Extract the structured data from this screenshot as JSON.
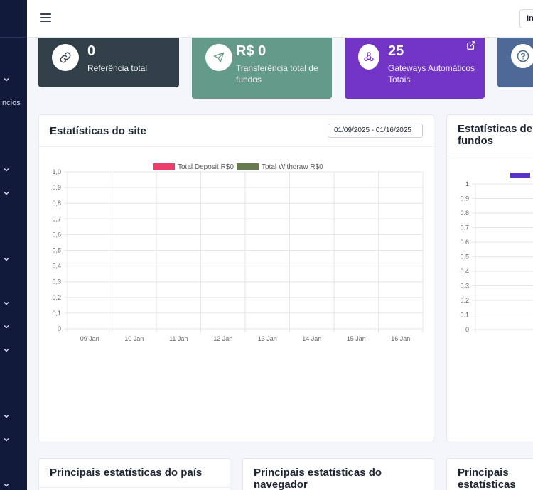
{
  "sidebar": {
    "fragment_label": "ıncios"
  },
  "topbar": {
    "right_button_label": "In"
  },
  "stats": [
    {
      "value": "0",
      "label": "Referência total",
      "color": "#313f48",
      "icon": "link-icon"
    },
    {
      "value": "R$ 0",
      "label": "Transferência total de fundos",
      "color": "#649a89",
      "icon": "send-icon"
    },
    {
      "value": "25",
      "label": "Gateways Automáticos Totais",
      "color": "#7134c4",
      "icon": "webhook-icon"
    },
    {
      "value": "",
      "label": "",
      "color": "#4c6a95",
      "icon": "help-icon"
    }
  ],
  "site_stats": {
    "title": "Estatísticas do site",
    "date_range": "01/09/2025 - 01/16/2025",
    "chart_data": {
      "type": "bar",
      "categories": [
        "09 Jan",
        "10 Jan",
        "11 Jan",
        "12 Jan",
        "13 Jan",
        "14 Jan",
        "15 Jan",
        "16 Jan"
      ],
      "series": [
        {
          "name": "Total Deposit R$0",
          "values": [
            0,
            0,
            0,
            0,
            0,
            0,
            0,
            0
          ],
          "color": "#ea3f6b"
        },
        {
          "name": "Total Withdraw R$0",
          "values": [
            0,
            0,
            0,
            0,
            0,
            0,
            0,
            0
          ],
          "color": "#667a4f"
        }
      ],
      "ylim": [
        0,
        1
      ],
      "yticks": [
        "0",
        "0,1",
        "0,2",
        "0,3",
        "0,4",
        "0,5",
        "0,6",
        "0,7",
        "0,8",
        "0,9",
        "1,0"
      ],
      "grid": true,
      "legend": "top-center"
    }
  },
  "fund_stats": {
    "title": "Estatísticas de fundos",
    "chart_data": {
      "type": "bar",
      "ylim": [
        0,
        1
      ],
      "yticks": [
        "0",
        "0.1",
        "0.2",
        "0.3",
        "0.4",
        "0.5",
        "0.6",
        "0.7",
        "0.8",
        "0.9",
        "1"
      ],
      "legend_color": "#5b34c9",
      "grid": true,
      "legend": "top-center"
    }
  },
  "bottom_cards": [
    {
      "title": "Principais estatísticas do país"
    },
    {
      "title": "Principais estatísticas do navegador"
    },
    {
      "title": "Principais estatísticas operacional"
    }
  ]
}
